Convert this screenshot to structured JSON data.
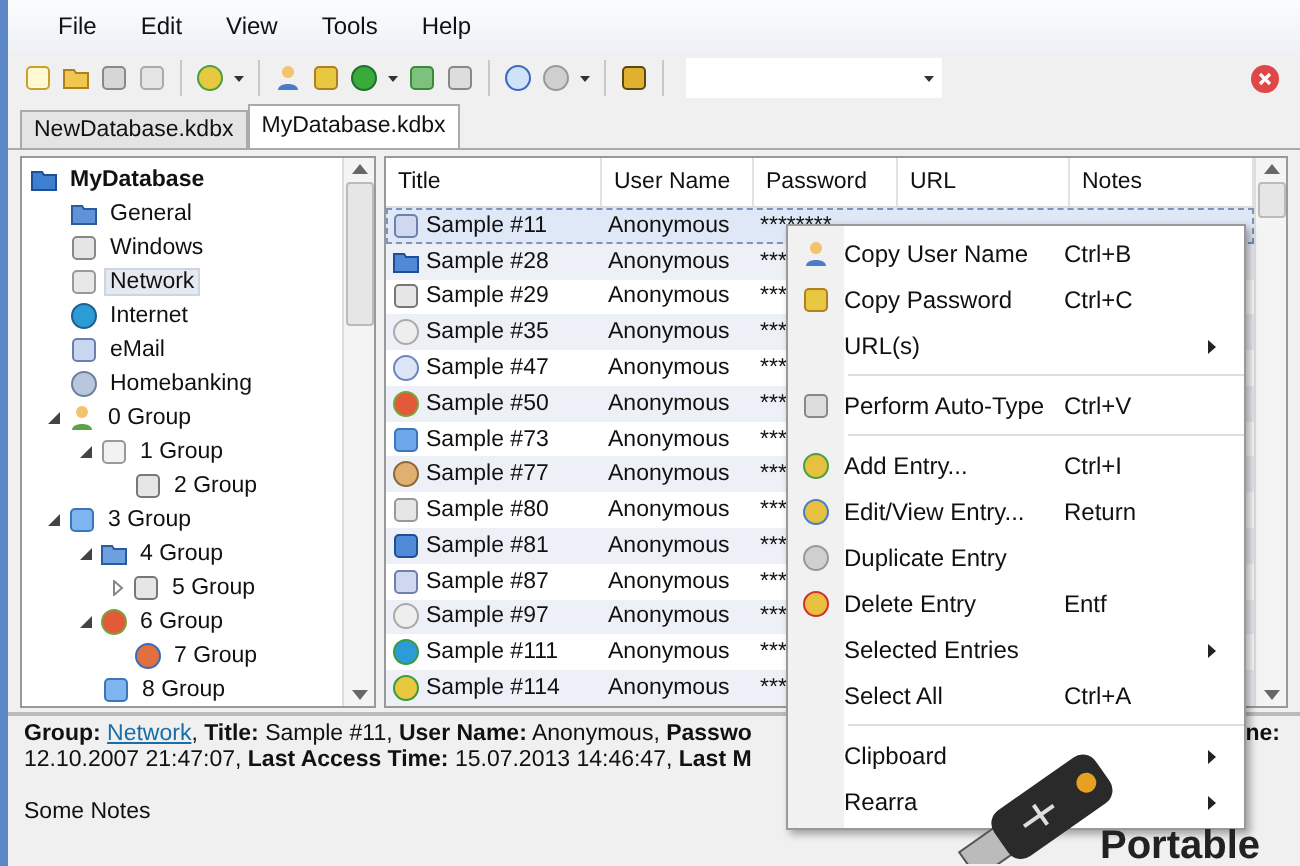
{
  "menu_bar": [
    "File",
    "Edit",
    "View",
    "Tools",
    "Help"
  ],
  "tabs": [
    {
      "label": "NewDatabase.kdbx",
      "selected": false
    },
    {
      "label": "MyDatabase.kdbx",
      "selected": true
    }
  ],
  "tree": {
    "label": "MyDatabase",
    "selected": false,
    "children": [
      {
        "label": "General",
        "selected": false
      },
      {
        "label": "Windows",
        "selected": false
      },
      {
        "label": "Network",
        "selected": true
      },
      {
        "label": "Internet",
        "selected": false
      },
      {
        "label": "eMail",
        "selected": false
      },
      {
        "label": "Homebanking",
        "selected": false
      },
      {
        "label": "0 Group",
        "selected": false,
        "expanded": true,
        "children": [
          {
            "label": "1 Group",
            "selected": false,
            "expanded": true,
            "children": [
              {
                "label": "2 Group",
                "selected": false
              }
            ]
          }
        ]
      },
      {
        "label": "3 Group",
        "selected": false,
        "expanded": true,
        "children": [
          {
            "label": "4 Group",
            "selected": false,
            "expanded": true,
            "children": [
              {
                "label": "5 Group",
                "selected": false,
                "expanded": false
              }
            ]
          },
          {
            "label": "6 Group",
            "selected": false,
            "expanded": true,
            "children": [
              {
                "label": "7 Group",
                "selected": false
              }
            ]
          },
          {
            "label": "8 Group",
            "selected": false
          }
        ]
      }
    ]
  },
  "table": {
    "columns": [
      "Title",
      "User Name",
      "Password",
      "URL",
      "Notes"
    ],
    "rows": [
      {
        "title": "Sample #11",
        "user": "Anonymous",
        "password": "********",
        "selected": true
      },
      {
        "title": "Sample #28",
        "user": "Anonymous",
        "password": "***",
        "selected": false
      },
      {
        "title": "Sample #29",
        "user": "Anonymous",
        "password": "***",
        "selected": false
      },
      {
        "title": "Sample #35",
        "user": "Anonymous",
        "password": "***",
        "selected": false
      },
      {
        "title": "Sample #47",
        "user": "Anonymous",
        "password": "***",
        "selected": false
      },
      {
        "title": "Sample #50",
        "user": "Anonymous",
        "password": "***",
        "selected": false
      },
      {
        "title": "Sample #73",
        "user": "Anonymous",
        "password": "***",
        "selected": false
      },
      {
        "title": "Sample #77",
        "user": "Anonymous",
        "password": "***",
        "selected": false
      },
      {
        "title": "Sample #80",
        "user": "Anonymous",
        "password": "***",
        "selected": false
      },
      {
        "title": "Sample #81",
        "user": "Anonymous",
        "password": "***",
        "selected": false
      },
      {
        "title": "Sample #87",
        "user": "Anonymous",
        "password": "***",
        "selected": false
      },
      {
        "title": "Sample #97",
        "user": "Anonymous",
        "password": "***",
        "selected": false
      },
      {
        "title": "Sample #111",
        "user": "Anonymous",
        "password": "***",
        "selected": false
      },
      {
        "title": "Sample #114",
        "user": "Anonymous",
        "password": "***",
        "selected": false
      }
    ]
  },
  "details": {
    "line_1": "**Group:** ",
    "group_link": "Network",
    "line_1_rest": ", **Title:** Sample #11, **User Name:** Anonymous, **Passwo**",
    "line_1_end": "**ne:**",
    "line_2": "12.10.2007 21:47:07, **Last Access Time:** 15.07.2013 14:46:47, **Last M**",
    "notes": "Some Notes"
  },
  "context_menu": [
    {
      "kind": "item",
      "label": "Copy User Name",
      "shortcut": "Ctrl+B"
    },
    {
      "kind": "item",
      "label": "Copy Password",
      "shortcut": "Ctrl+C"
    },
    {
      "kind": "submenu",
      "label": "URL(s)"
    },
    {
      "kind": "separator"
    },
    {
      "kind": "item",
      "label": "Perform Auto-Type",
      "shortcut": "Ctrl+V"
    },
    {
      "kind": "separator"
    },
    {
      "kind": "item",
      "label": "Add Entry...",
      "shortcut": "Ctrl+I"
    },
    {
      "kind": "item",
      "label": "Edit/View Entry...",
      "shortcut": "Return"
    },
    {
      "kind": "item",
      "label": "Duplicate Entry"
    },
    {
      "kind": "item",
      "label": "Delete Entry",
      "shortcut": "Entf"
    },
    {
      "kind": "submenu",
      "label": "Selected Entries"
    },
    {
      "kind": "item",
      "label": "Select All",
      "shortcut": "Ctrl+A"
    },
    {
      "kind": "separator"
    },
    {
      "kind": "submenu",
      "label": "Clipboard"
    },
    {
      "kind": "submenu",
      "label": "Rearra"
    }
  ],
  "promo": {
    "label": "Portable"
  }
}
